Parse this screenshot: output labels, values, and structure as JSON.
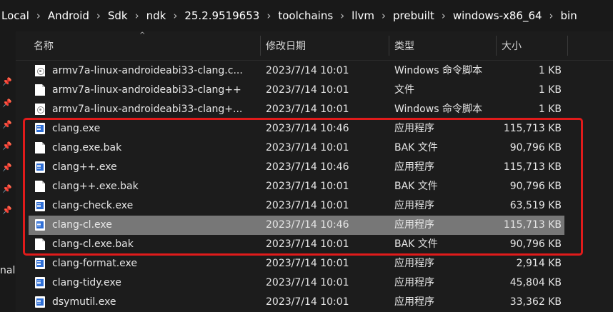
{
  "breadcrumb": [
    "Local",
    "Android",
    "Sdk",
    "ndk",
    "25.2.9519653",
    "toolchains",
    "llvm",
    "prebuilt",
    "windows-x86_64",
    "bin"
  ],
  "nav": {
    "partial_label": "nal"
  },
  "columns": {
    "name": "名称",
    "date": "修改日期",
    "type": "类型",
    "size": "大小"
  },
  "rows": [
    {
      "name": "armv7a-linux-androideabi33-clang.c...",
      "date": "2023/7/14 10:01",
      "type": "Windows 命令脚本",
      "size": "1 KB",
      "icon": "script-icon"
    },
    {
      "name": "armv7a-linux-androideabi33-clang++",
      "date": "2023/7/14 10:01",
      "type": "文件",
      "size": "1 KB",
      "icon": "file-icon"
    },
    {
      "name": "armv7a-linux-androideabi33-clang+...",
      "date": "2023/7/14 10:01",
      "type": "Windows 命令脚本",
      "size": "1 KB",
      "icon": "script-icon"
    },
    {
      "name": "clang.exe",
      "date": "2023/7/14 10:46",
      "type": "应用程序",
      "size": "115,713 KB",
      "icon": "exe-icon"
    },
    {
      "name": "clang.exe.bak",
      "date": "2023/7/14 10:01",
      "type": "BAK 文件",
      "size": "90,796 KB",
      "icon": "file-icon"
    },
    {
      "name": "clang++.exe",
      "date": "2023/7/14 10:46",
      "type": "应用程序",
      "size": "115,713 KB",
      "icon": "exe-icon"
    },
    {
      "name": "clang++.exe.bak",
      "date": "2023/7/14 10:01",
      "type": "BAK 文件",
      "size": "90,796 KB",
      "icon": "file-icon"
    },
    {
      "name": "clang-check.exe",
      "date": "2023/7/14 10:01",
      "type": "应用程序",
      "size": "63,519 KB",
      "icon": "exe-icon"
    },
    {
      "name": "clang-cl.exe",
      "date": "2023/7/14 10:46",
      "type": "应用程序",
      "size": "115,713 KB",
      "icon": "exe-icon",
      "selected": true
    },
    {
      "name": "clang-cl.exe.bak",
      "date": "2023/7/14 10:01",
      "type": "BAK 文件",
      "size": "90,796 KB",
      "icon": "file-icon"
    },
    {
      "name": "clang-format.exe",
      "date": "2023/7/14 10:01",
      "type": "应用程序",
      "size": "2,914 KB",
      "icon": "exe-icon"
    },
    {
      "name": "clang-tidy.exe",
      "date": "2023/7/14 10:01",
      "type": "应用程序",
      "size": "45,804 KB",
      "icon": "exe-icon"
    },
    {
      "name": "dsymutil.exe",
      "date": "2023/7/14 10:01",
      "type": "应用程序",
      "size": "33,362 KB",
      "icon": "exe-icon"
    }
  ],
  "colors": {
    "highlight": "#e01b1b",
    "selected_row": "#777777",
    "background": "#1c1c1c"
  }
}
